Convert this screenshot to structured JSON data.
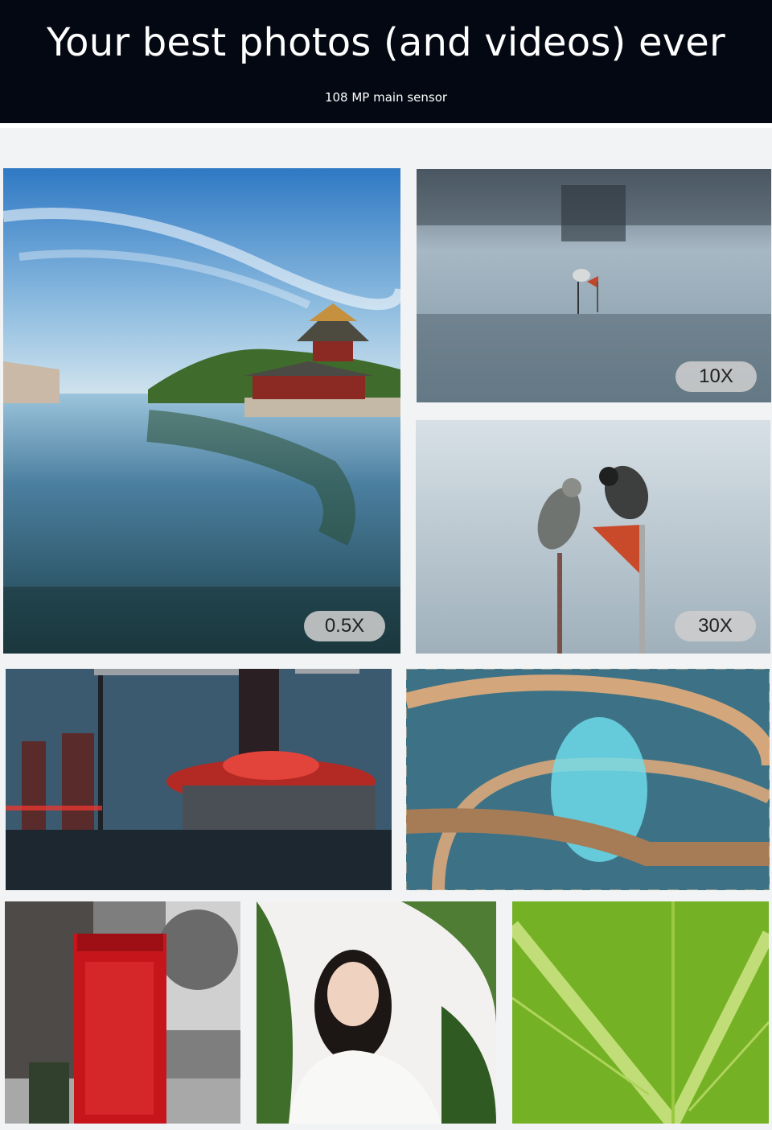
{
  "hero": {
    "title": "Your best photos (and videos) ever",
    "subtitle": "108 MP main sensor"
  },
  "gallery": {
    "zoom_labels": [
      "0.5X",
      "10X",
      "30X"
    ]
  }
}
